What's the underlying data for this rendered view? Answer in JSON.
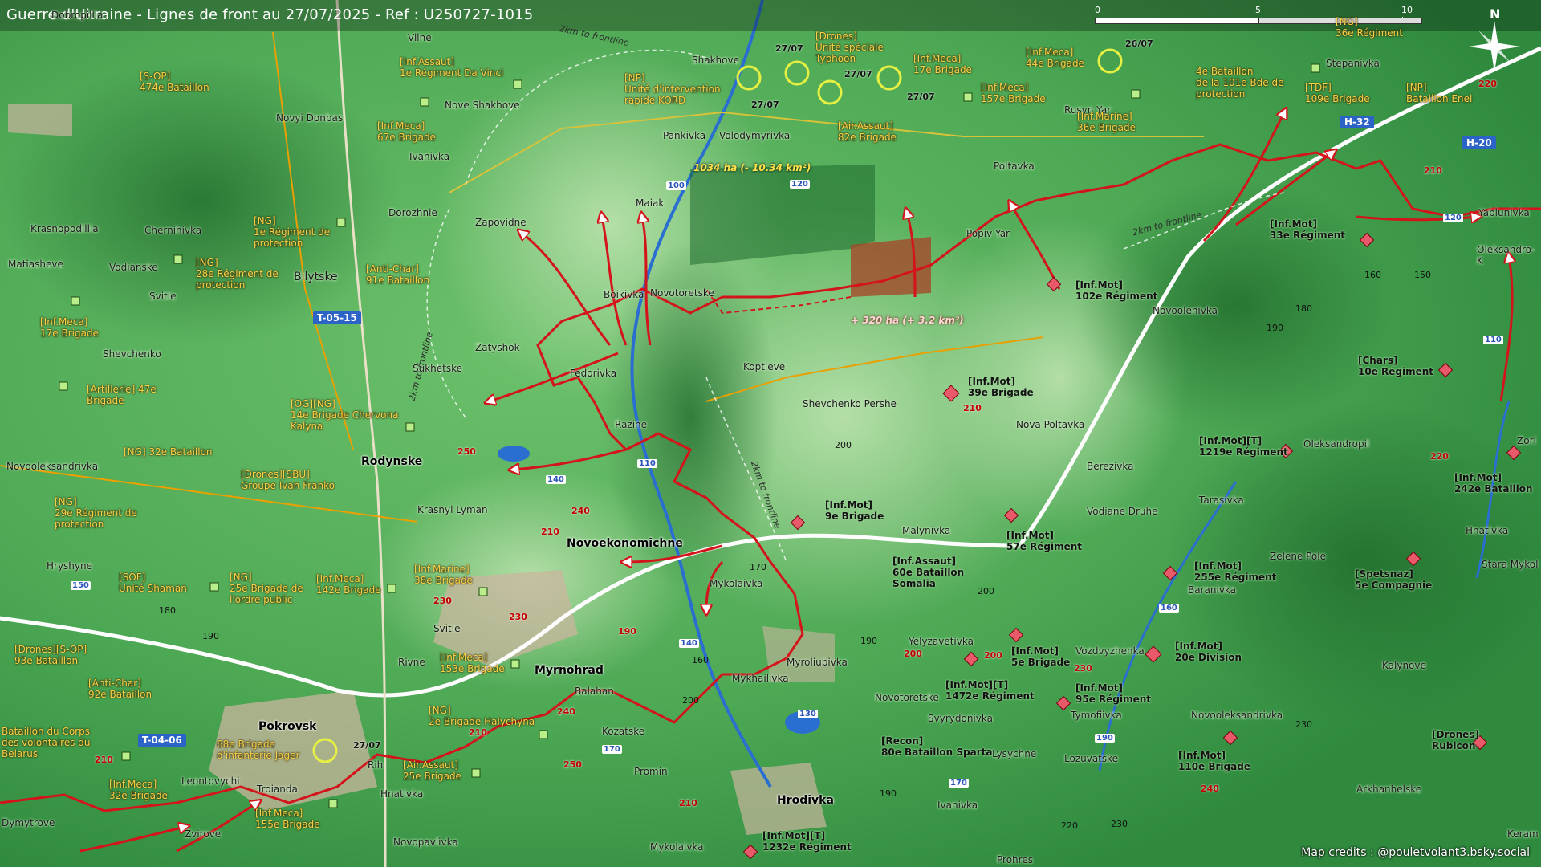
{
  "title": "Guerre d'Ukraine - Lignes de front au 27/07/2025 - Ref : U250727-1015",
  "scale": {
    "zero": "0",
    "mid": "5",
    "end": "10 km"
  },
  "north_label": "N",
  "credits": "Map credits : @pouletvolant3.bsky.social",
  "annotations": {
    "loss": "1034 ha (- 10.34 km²)",
    "gain": "+ 320 ha (+ 3.2 km²)",
    "frontline_2km": "2km to frontline"
  },
  "dates": [
    "27/07",
    "27/07",
    "27/07",
    "27/07",
    "26/07",
    "27/07"
  ],
  "colors": {
    "ua_units": "#f6d24a",
    "front_line": "#d4141b",
    "russian_marker": "#e8596a",
    "ua_zone": "#1e6a2e",
    "ru_zone": "#a54a2a"
  },
  "icons": {
    "ua_unit": "ua-unit-icon",
    "ru_unit": "ru-unit-icon",
    "objective": "objective-icon",
    "arrow": "attack-arrow-icon",
    "compass": "north-arrow-icon"
  },
  "road_labels": [
    "H-32",
    "H-20",
    "T-05-15",
    "T-04-06"
  ],
  "road_numbers": [
    "100",
    "120",
    "110",
    "140",
    "160",
    "170",
    "190",
    "130",
    "150"
  ],
  "towns": [
    {
      "name": "Dobropillia",
      "city": false
    },
    {
      "name": "Vilne",
      "city": false
    },
    {
      "name": "Nove Shakhove",
      "city": false
    },
    {
      "name": "Novyi Donbas",
      "city": false
    },
    {
      "name": "Ivanivka",
      "city": false
    },
    {
      "name": "Dorozhnie",
      "city": false
    },
    {
      "name": "Shakhove",
      "city": false
    },
    {
      "name": "Pankivka",
      "city": false
    },
    {
      "name": "Volodymyrivka",
      "city": false
    },
    {
      "name": "Maiak",
      "city": false
    },
    {
      "name": "Zapovidne",
      "city": false
    },
    {
      "name": "Krasnopodillia",
      "city": false
    },
    {
      "name": "Chernihivka",
      "city": false
    },
    {
      "name": "Matiasheve",
      "city": false
    },
    {
      "name": "Vodianske",
      "city": false
    },
    {
      "name": "Svitle",
      "city": false
    },
    {
      "name": "Bilytske",
      "city": false
    },
    {
      "name": "Boikivka",
      "city": false
    },
    {
      "name": "Novotoretske",
      "city": false
    },
    {
      "name": "Shevchenko",
      "city": false
    },
    {
      "name": "Zatyshok",
      "city": false
    },
    {
      "name": "Sukhetske",
      "city": false
    },
    {
      "name": "Fedorivka",
      "city": false
    },
    {
      "name": "Koptieve",
      "city": false
    },
    {
      "name": "Shevchenko Pershe",
      "city": false
    },
    {
      "name": "Razine",
      "city": false
    },
    {
      "name": "Rodynske",
      "city": true
    },
    {
      "name": "Novooleksandrivka",
      "city": false
    },
    {
      "name": "Krasnyi Lyman",
      "city": false
    },
    {
      "name": "Novoekonomichne",
      "city": true
    },
    {
      "name": "Malynivka",
      "city": false
    },
    {
      "name": "Hryshyne",
      "city": false
    },
    {
      "name": "Mykolaivka",
      "city": false
    },
    {
      "name": "Svitle",
      "city": false
    },
    {
      "name": "Rivne",
      "city": false
    },
    {
      "name": "Myrnohrad",
      "city": true
    },
    {
      "name": "Myroliubivka",
      "city": false
    },
    {
      "name": "Mykhailivka",
      "city": false
    },
    {
      "name": "Balahan",
      "city": false
    },
    {
      "name": "Pokrovsk",
      "city": true
    },
    {
      "name": "Kozatske",
      "city": false
    },
    {
      "name": "Promin",
      "city": false
    },
    {
      "name": "Leontovychi",
      "city": false
    },
    {
      "name": "Troianda",
      "city": false
    },
    {
      "name": "Rih",
      "city": false
    },
    {
      "name": "Hnativka",
      "city": false
    },
    {
      "name": "Hrodivka",
      "city": true
    },
    {
      "name": "Dymytrove",
      "city": false
    },
    {
      "name": "Zvirove",
      "city": false
    },
    {
      "name": "Novopavlivka",
      "city": false
    },
    {
      "name": "Mykolaivka",
      "city": false
    },
    {
      "name": "Prohres",
      "city": false
    },
    {
      "name": "Stepanivka",
      "city": false
    },
    {
      "name": "Rusyn Yar",
      "city": false
    },
    {
      "name": "Poltavka",
      "city": false
    },
    {
      "name": "Popiv Yar",
      "city": false
    },
    {
      "name": "Novoolenivka",
      "city": false
    },
    {
      "name": "Yablunivka",
      "city": false
    },
    {
      "name": "Oleksandro-K",
      "city": false
    },
    {
      "name": "Nova Poltavka",
      "city": false
    },
    {
      "name": "Oleksandropil",
      "city": false
    },
    {
      "name": "Berezivka",
      "city": false
    },
    {
      "name": "Vodiane Druhe",
      "city": false
    },
    {
      "name": "Tarasivka",
      "city": false
    },
    {
      "name": "Zelene Pole",
      "city": false
    },
    {
      "name": "Hnativka",
      "city": false
    },
    {
      "name": "Stara Mykol",
      "city": false
    },
    {
      "name": "Baranivka",
      "city": false
    },
    {
      "name": "Yelyzavetivka",
      "city": false
    },
    {
      "name": "Vozdvyzhenka",
      "city": false
    },
    {
      "name": "Novotoretske",
      "city": false
    },
    {
      "name": "Svyrydonivka",
      "city": false
    },
    {
      "name": "Tymofiivka",
      "city": false
    },
    {
      "name": "Novooleksandrivka",
      "city": false
    },
    {
      "name": "Lysychne",
      "city": false
    },
    {
      "name": "Lozuvatske",
      "city": false
    },
    {
      "name": "Ivanivka",
      "city": false
    },
    {
      "name": "Kalynove",
      "city": false
    },
    {
      "name": "Arkhanhelske",
      "city": false
    },
    {
      "name": "Keram",
      "city": false
    },
    {
      "name": "Zori",
      "city": false
    }
  ],
  "ua_units": [
    "[S-OP]\n474e Bataillon",
    "[Inf.Assaut]\n1e Régiment Da Vinci",
    "[NP]\nUnité d'intervention\nrapide KORD",
    "[Drones]\nUnité spéciale\nTyphoon",
    "[Inf.Meca]\n17e Brigade",
    "[Inf.Meca]\n44e Brigade",
    "[Inf.Meca]\n157e Brigade",
    "[Air.Assaut]\n82e Brigade",
    "[Inf.Meca]\n67e Brigade",
    "[NG]\n1e Régiment de\nprotection",
    "[NG]\n28e Régiment de\nprotection",
    "[Anti-Char]\n91e Bataillon",
    "[Inf.Meca]\n17e Brigade",
    "[Artillerie] 47e\nBrigade",
    "[OG][NG]\n14e Brigade Chervona\nKalyna",
    "[NG] 32e Bataillon",
    "[Drones][SBU]\nGroupe Ivan Franko",
    "[NG]\n29e Régiment de\nprotection",
    "[SOF]\nUnité Shaman",
    "[NG]\n25e Brigade de\nl'ordre public",
    "[Inf.Meca]\n142e Brigade",
    "[Inf.Marine]\n38e Brigade",
    "[Drones][S-OP]\n93e Bataillon",
    "[Inf.Meca]\n153e Brigade",
    "[Anti-Char]\n92e Bataillon",
    "[NG]\n2e Brigade Halychyna",
    "Bataillon du Corps\ndes volontaires du\nBelarus",
    "68e Brigade\nd'infanterie Jager",
    "[Air.Assaut]\n25e Brigade",
    "[Inf.Meca]\n32e Brigade",
    "[Inf.Meca]\n155e Brigade",
    "[NG]\n36e Régiment",
    "4e Bataillon\nde la 101e Bde de\nprotection",
    "[TDF]\n109e Brigade",
    "[NP]\nBataillon Enei",
    "[Inf.Marine]\n36e Brigade"
  ],
  "ru_units": [
    "[Inf.Mot]\n33e Régiment",
    "[Inf.Mot]\n102e Régiment",
    "[Inf.Mot]\n39e Brigade",
    "[Chars]\n10e Régiment",
    "[Inf.Mot][T]\n1219e Régiment",
    "[Inf.Mot]\n242e Bataillon",
    "[Inf.Mot]\n9e Brigade",
    "[Inf.Mot]\n57e Régiment",
    "[Inf.Assaut]\n60e Bataillon\nSomalia",
    "[Inf.Mot]\n255e Régiment",
    "[Spetsnaz]\n5e Compagnie",
    "[Inf.Mot]\n5e Brigade",
    "[Inf.Mot]\n20e Division",
    "[Inf.Mot][T]\n1472e Régiment",
    "[Inf.Mot]\n95e Régiment",
    "[Recon]\n80e Bataillon Sparta",
    "[Inf.Mot]\n110e Brigade",
    "[Drones]\nRubicon",
    "[Inf.Mot][T]\n1232e Régiment"
  ],
  "elevations": [
    "150",
    "180",
    "190",
    "200",
    "210",
    "220",
    "230",
    "240",
    "250",
    "170",
    "160",
    "140"
  ]
}
